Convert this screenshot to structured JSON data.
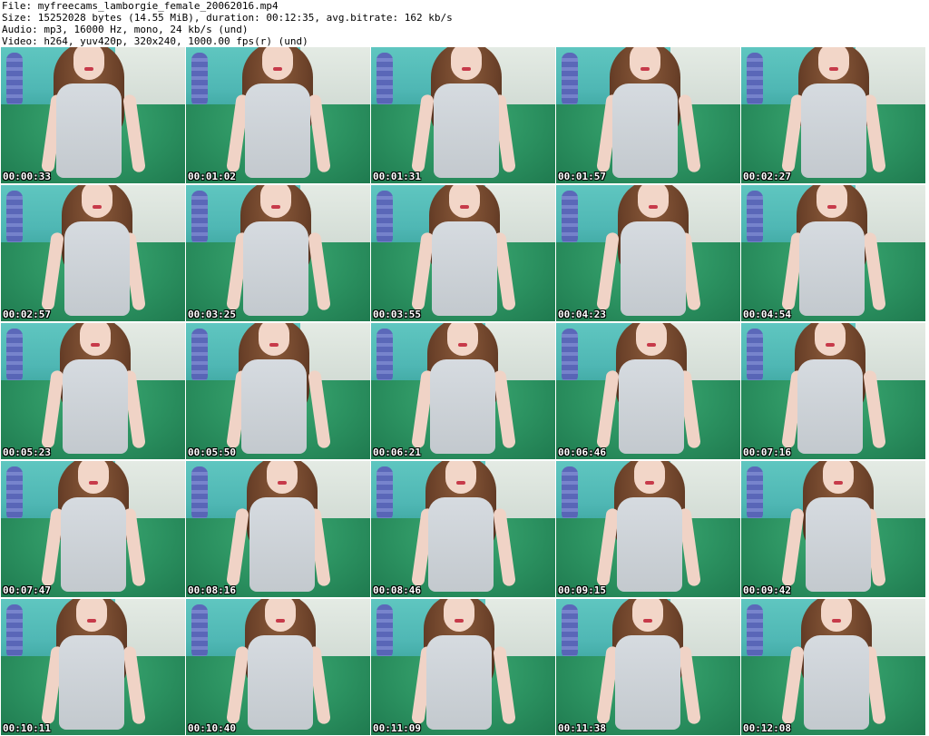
{
  "header": {
    "file": "File: myfreecams_lamborgie_female_20062016.mp4",
    "size": "Size: 15252028 bytes (14.55 MiB), duration: 00:12:35, avg.bitrate: 162 kb/s",
    "audio": "Audio: mp3, 16000 Hz, mono, 24 kb/s (und)",
    "video": "Video: h264, yuv420p, 320x240, 1000.00 fps(r) (und)"
  },
  "thumbnails": [
    {
      "time": "00:00:33"
    },
    {
      "time": "00:01:02"
    },
    {
      "time": "00:01:31"
    },
    {
      "time": "00:01:57"
    },
    {
      "time": "00:02:27"
    },
    {
      "time": "00:02:57"
    },
    {
      "time": "00:03:25"
    },
    {
      "time": "00:03:55"
    },
    {
      "time": "00:04:23"
    },
    {
      "time": "00:04:54"
    },
    {
      "time": "00:05:23"
    },
    {
      "time": "00:05:50"
    },
    {
      "time": "00:06:21"
    },
    {
      "time": "00:06:46"
    },
    {
      "time": "00:07:16"
    },
    {
      "time": "00:07:47"
    },
    {
      "time": "00:08:16"
    },
    {
      "time": "00:08:46"
    },
    {
      "time": "00:09:15"
    },
    {
      "time": "00:09:42"
    },
    {
      "time": "00:10:11"
    },
    {
      "time": "00:10:40"
    },
    {
      "time": "00:11:09"
    },
    {
      "time": "00:11:38"
    },
    {
      "time": "00:12:08"
    }
  ]
}
